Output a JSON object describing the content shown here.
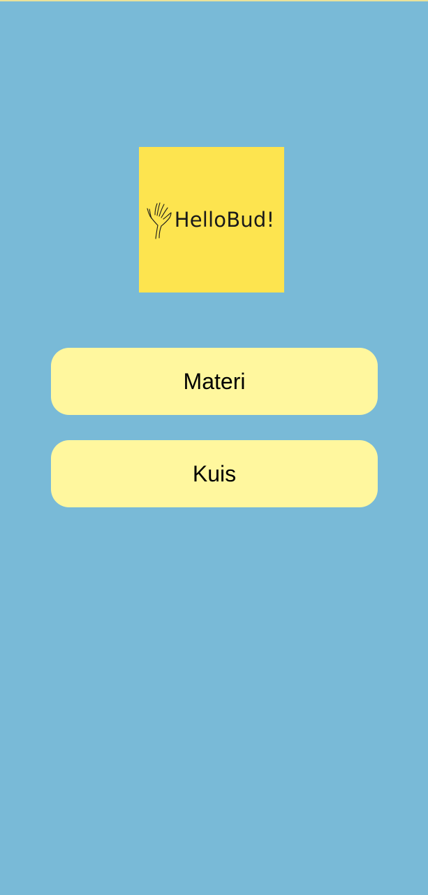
{
  "app": {
    "logo": {
      "text": "HelloBud!",
      "icon": "waving-hand-icon"
    },
    "menu": {
      "materi_label": "Materi",
      "kuis_label": "Kuis"
    }
  },
  "colors": {
    "background": "#79bad7",
    "logo_tile": "#fde44f",
    "button_fill": "#fff79e",
    "text": "#000000"
  }
}
